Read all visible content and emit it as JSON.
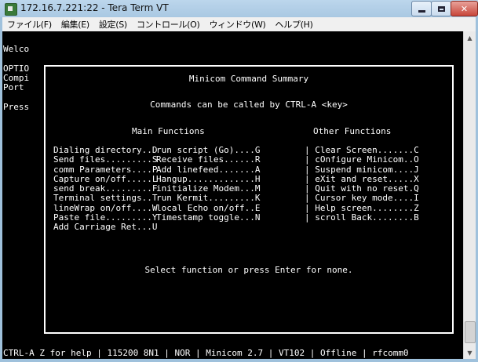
{
  "window": {
    "title": "172.16.7.221:22 - Tera Term VT"
  },
  "menu": [
    "ファイル(F)",
    "編集(E)",
    "設定(S)",
    "コントロール(O)",
    "ウィンドウ(W)",
    "ヘルプ(H)"
  ],
  "terminal": {
    "side_lines": [
      "Welco",
      "",
      "OPTIO",
      "Compi",
      "Port",
      "",
      "Press"
    ],
    "dialog": {
      "title": "Minicom Command Summary",
      "subtitle": "Commands can be called by CTRL-A <key>",
      "main_heading": "Main Functions",
      "other_heading": "Other Functions",
      "main_functions": [
        "Dialing directory..D",
        "Send files.........S",
        "comm Parameters....P",
        "Capture on/off.....L",
        "send break.........F",
        "Terminal settings..T",
        "lineWrap on/off....W",
        "Paste file.........Y",
        "Add Carriage Ret...U"
      ],
      "main_functions_2": [
        "run script (Go)....G",
        "Receive files......R",
        "Add linefeed.......A",
        "Hangup.............H",
        "initialize Modem...M",
        "run Kermit.........K",
        "local Echo on/off..E",
        "Timestamp toggle...N"
      ],
      "other_functions": [
        "| Clear Screen.......C",
        "| cOnfigure Minicom..O",
        "| Suspend minicom....J",
        "| eXit and reset.....X",
        "| Quit with no reset.Q",
        "| Cursor key mode....I",
        "| Help screen........Z",
        "| scroll Back........B"
      ],
      "footer": "Select function or press Enter for none."
    },
    "status_line": "CTRL-A Z for help | 115200 8N1 | NOR | Minicom 2.7 | VT102 | Offline | rfcomm0"
  },
  "icons": {
    "app": "tera-term-icon",
    "minimize": "minimize-icon",
    "maximize": "maximize-icon",
    "close": "close-icon"
  },
  "colors": {
    "terminal_bg": "#000000",
    "terminal_fg": "#ffffff",
    "titlebar": "#a9c8e2",
    "close_button": "#c8463a"
  }
}
